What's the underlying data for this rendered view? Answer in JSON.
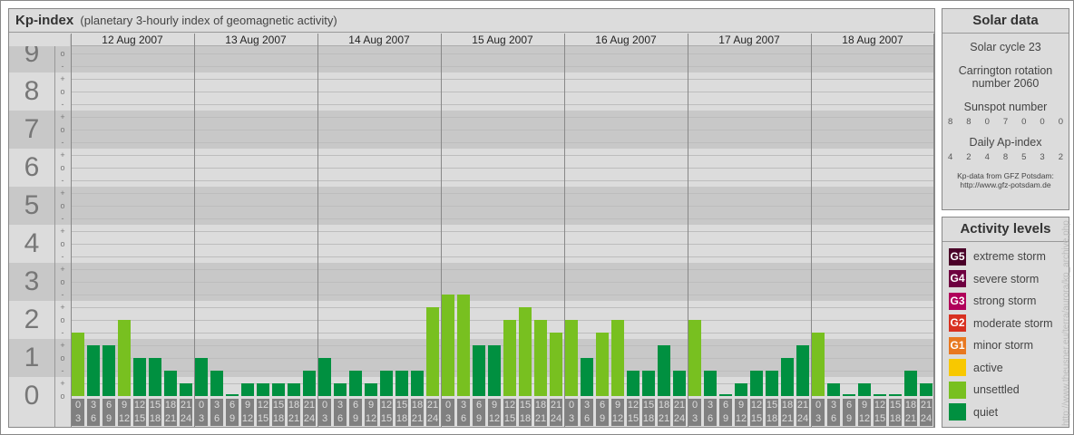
{
  "header": {
    "title": "Kp-index",
    "subtitle": "(planetary 3-hourly index of geomagnetic activity)"
  },
  "chart_data": {
    "type": "bar",
    "title": "Kp-index",
    "subtitle": "(planetary 3-hourly index of geomagnetic activity)",
    "yticks": [
      "0",
      "1",
      "2",
      "3",
      "4",
      "5",
      "6",
      "7",
      "8",
      "9"
    ],
    "subticks": [
      "o",
      "+",
      "-"
    ],
    "ylim": [
      0,
      9
    ],
    "days": [
      "12 Aug 2007",
      "13 Aug 2007",
      "14 Aug 2007",
      "15 Aug 2007",
      "16 Aug 2007",
      "17 Aug 2007",
      "18 Aug 2007"
    ],
    "intervals": [
      [
        "0",
        "3"
      ],
      [
        "3",
        "6"
      ],
      [
        "6",
        "9"
      ],
      [
        "9",
        "12"
      ],
      [
        "12",
        "15"
      ],
      [
        "15",
        "18"
      ],
      [
        "18",
        "21"
      ],
      [
        "21",
        "24"
      ]
    ],
    "series": [
      {
        "name": "12 Aug 2007",
        "values": [
          "2-",
          "1+",
          "1+",
          "2o",
          "1o",
          "1o",
          "1-",
          "0+"
        ]
      },
      {
        "name": "13 Aug 2007",
        "values": [
          "1o",
          "1-",
          "0o",
          "0+",
          "0+",
          "0+",
          "0+",
          "1-"
        ]
      },
      {
        "name": "14 Aug 2007",
        "values": [
          "1o",
          "0+",
          "1-",
          "0+",
          "1-",
          "1-",
          "1-",
          "2+"
        ]
      },
      {
        "name": "15 Aug 2007",
        "values": [
          "3-",
          "3-",
          "1+",
          "1+",
          "2o",
          "2+",
          "2o",
          "2-"
        ]
      },
      {
        "name": "16 Aug 2007",
        "values": [
          "2o",
          "1o",
          "2-",
          "2o",
          "1-",
          "1-",
          "1+",
          "1-"
        ]
      },
      {
        "name": "17 Aug 2007",
        "values": [
          "2o",
          "1-",
          "0o",
          "0+",
          "1-",
          "1-",
          "1o",
          "1+"
        ]
      },
      {
        "name": "18 Aug 2007",
        "values": [
          "2-",
          "0+",
          "0o",
          "0+",
          "0o",
          "0o",
          "1-",
          "0+"
        ]
      }
    ]
  },
  "solar": {
    "heading": "Solar data",
    "cycle": "Solar cycle 23",
    "carrington1": "Carrington rotation",
    "carrington2": "number 2060",
    "sunspot_label": "Sunspot number",
    "sunspots": [
      "8",
      "8",
      "0",
      "7",
      "0",
      "0",
      "0"
    ],
    "ap_label": "Daily Ap-index",
    "ap": [
      "4",
      "2",
      "4",
      "8",
      "5",
      "3",
      "2"
    ],
    "source1": "Kp-data from GFZ Potsdam:",
    "source2": "http://www.gfz-potsdam.de"
  },
  "activity": {
    "heading": "Activity levels",
    "levels": [
      {
        "badge": "G5",
        "label": "extreme storm",
        "color": "#4a0028"
      },
      {
        "badge": "G4",
        "label": "severe storm",
        "color": "#6e0040"
      },
      {
        "badge": "G3",
        "label": "strong storm",
        "color": "#b0005a"
      },
      {
        "badge": "G2",
        "label": "moderate storm",
        "color": "#d83020"
      },
      {
        "badge": "G1",
        "label": "minor storm",
        "color": "#e87820"
      },
      {
        "badge": "",
        "label": "active",
        "color": "#f8c800"
      },
      {
        "badge": "",
        "label": "unsettled",
        "color": "#78c020"
      },
      {
        "badge": "",
        "label": "quiet",
        "color": "#009040"
      }
    ]
  },
  "watermark": "http://www.theusner.eu/terra/aurora/kp_archive.php"
}
